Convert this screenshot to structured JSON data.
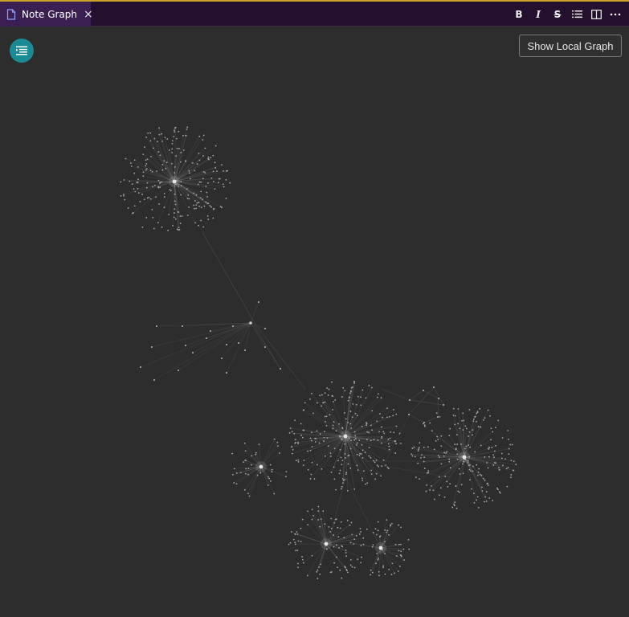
{
  "tab": {
    "title": "Note Graph",
    "icon": "file-icon",
    "close_icon": "close-icon"
  },
  "toolbar": {
    "bold_label": "B",
    "italic_label": "I",
    "strike_label": "S",
    "items": [
      "bold-icon",
      "italic-icon",
      "strikethrough-icon",
      "list-icon",
      "split-view-icon",
      "more-icon"
    ]
  },
  "graph": {
    "fab_icon": "outline-icon",
    "show_local_label": "Show Local Graph"
  },
  "colors": {
    "accent_line": "#c9a227",
    "tabbar": "#24102e",
    "active_tab": "#3b1f52",
    "fab": "#1a8a95",
    "background": "#2d2d2d"
  }
}
